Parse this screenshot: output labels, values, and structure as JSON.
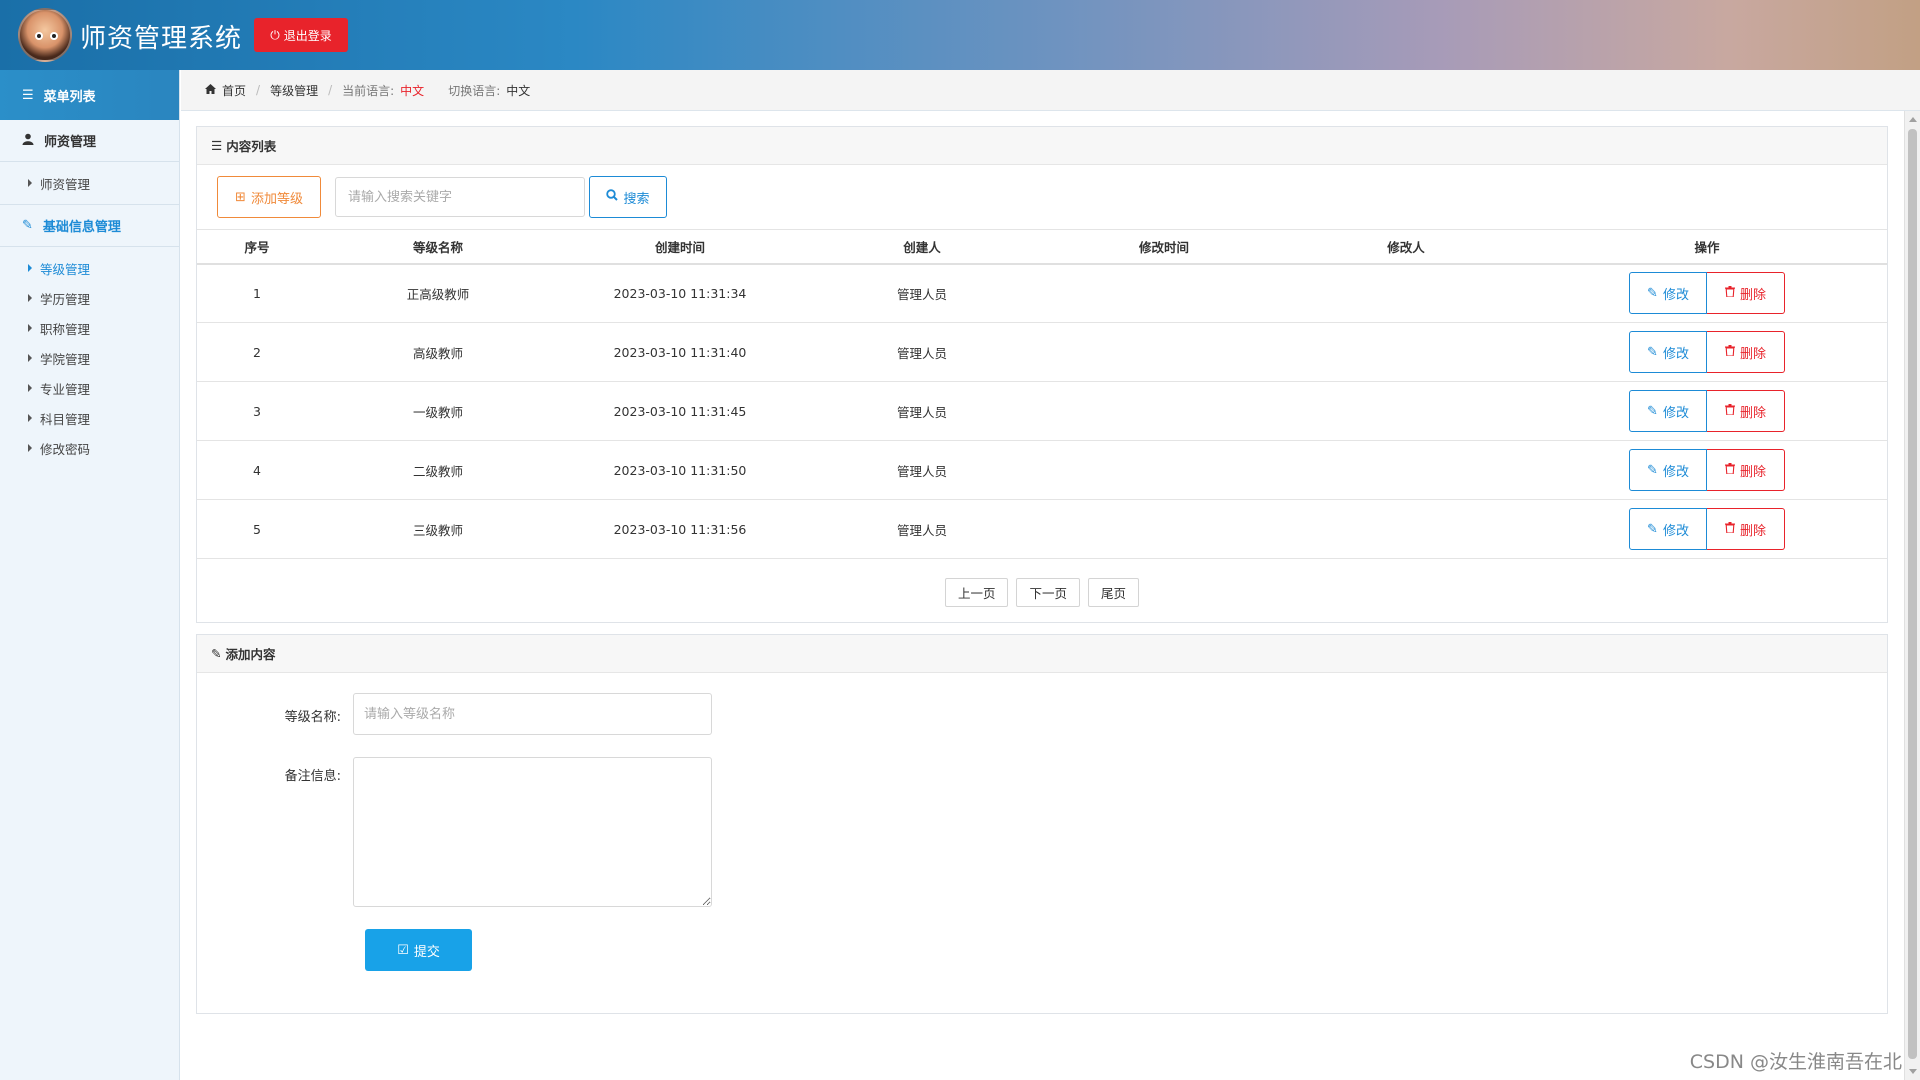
{
  "header": {
    "title": "师资管理系统",
    "logout_label": "退出登录",
    "accent": "#e8232b"
  },
  "sidebar": {
    "menu_title": "菜单列表",
    "groups": [
      {
        "label": "师资管理",
        "items": [
          {
            "label": "师资管理"
          }
        ]
      },
      {
        "label": "基础信息管理",
        "active": true,
        "items": [
          {
            "label": "等级管理",
            "active": true
          },
          {
            "label": "学历管理"
          },
          {
            "label": "职称管理"
          },
          {
            "label": "学院管理"
          },
          {
            "label": "专业管理"
          },
          {
            "label": "科目管理"
          },
          {
            "label": "修改密码"
          }
        ]
      }
    ]
  },
  "breadcrumb": {
    "home": "首页",
    "current": "等级管理",
    "lang_label": "当前语言:",
    "lang_value": "中文",
    "switch_label": "切换语言:",
    "switch_value": "中文"
  },
  "list_panel": {
    "title": "内容列表",
    "add_label": "添加等级",
    "search_placeholder": "请输入搜索关键字",
    "search_label": "搜索",
    "columns": [
      "序号",
      "等级名称",
      "创建时间",
      "创建人",
      "修改时间",
      "修改人",
      "操作"
    ],
    "rows": [
      {
        "id": "1",
        "name": "正高级教师",
        "created": "2023-03-10 11:31:34",
        "creator": "管理人员",
        "modified": "",
        "modifier": ""
      },
      {
        "id": "2",
        "name": "高级教师",
        "created": "2023-03-10 11:31:40",
        "creator": "管理人员",
        "modified": "",
        "modifier": ""
      },
      {
        "id": "3",
        "name": "一级教师",
        "created": "2023-03-10 11:31:45",
        "creator": "管理人员",
        "modified": "",
        "modifier": ""
      },
      {
        "id": "4",
        "name": "二级教师",
        "created": "2023-03-10 11:31:50",
        "creator": "管理人员",
        "modified": "",
        "modifier": ""
      },
      {
        "id": "5",
        "name": "三级教师",
        "created": "2023-03-10 11:31:56",
        "creator": "管理人员",
        "modified": "",
        "modifier": ""
      }
    ],
    "edit_label": "修改",
    "delete_label": "删除",
    "pager": {
      "prev": "上一页",
      "next": "下一页",
      "last": "尾页"
    }
  },
  "form_panel": {
    "title": "添加内容",
    "name_label": "等级名称:",
    "name_placeholder": "请输入等级名称",
    "note_label": "备注信息:",
    "submit_label": "提交"
  },
  "watermark": "CSDN @汝生淮南吾在北"
}
